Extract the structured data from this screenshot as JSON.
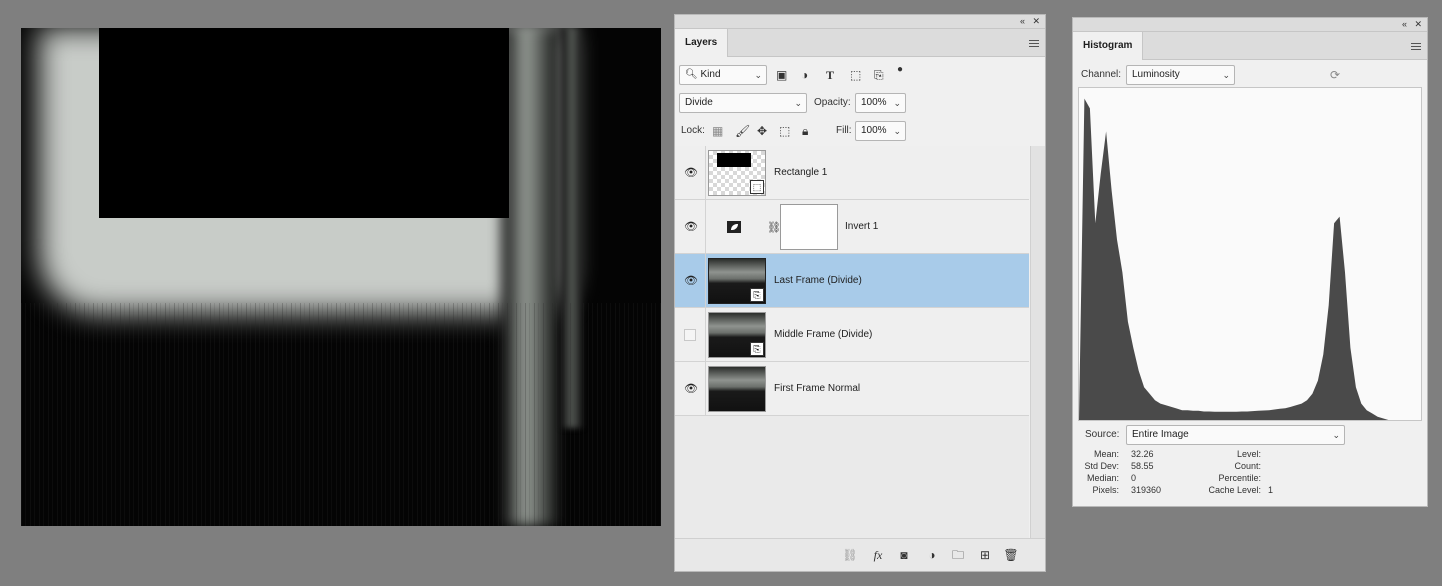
{
  "layers_panel": {
    "tab_label": "Layers",
    "filter": {
      "value": "Kind"
    },
    "blend_mode": "Divide",
    "opacity_label": "Opacity:",
    "opacity_value": "100%",
    "lock_label": "Lock:",
    "fill_label": "Fill:",
    "fill_value": "100%",
    "layers": [
      {
        "name": "Rectangle 1",
        "visible": true,
        "selected": false,
        "type": "shape"
      },
      {
        "name": "Invert 1",
        "visible": true,
        "selected": false,
        "type": "adjustment"
      },
      {
        "name": "Last Frame (Divide)",
        "visible": true,
        "selected": true,
        "type": "smart-object"
      },
      {
        "name": "Middle Frame (Divide)",
        "visible": false,
        "selected": false,
        "type": "smart-object"
      },
      {
        "name": "First Frame Normal",
        "visible": true,
        "selected": false,
        "type": "pixel"
      }
    ],
    "footer_icons": [
      "link-icon",
      "fx-icon",
      "mask-icon",
      "adjustment-icon",
      "folder-icon",
      "new-layer-icon",
      "trash-icon"
    ]
  },
  "histogram_panel": {
    "tab_label": "Histogram",
    "channel_label": "Channel:",
    "channel_value": "Luminosity",
    "source_label": "Source:",
    "source_value": "Entire Image",
    "stats_left": [
      {
        "label": "Mean:",
        "value": "32.26"
      },
      {
        "label": "Std Dev:",
        "value": "58.55"
      },
      {
        "label": "Median:",
        "value": "0"
      },
      {
        "label": "Pixels:",
        "value": "319360"
      }
    ],
    "stats_right": [
      {
        "label": "Level:",
        "value": ""
      },
      {
        "label": "Count:",
        "value": ""
      },
      {
        "label": "Percentile:",
        "value": ""
      },
      {
        "label": "Cache Level:",
        "value": "1"
      }
    ],
    "histogram_profile": [
      0,
      0.98,
      0.95,
      0.6,
      0.75,
      0.88,
      0.7,
      0.55,
      0.45,
      0.3,
      0.22,
      0.15,
      0.1,
      0.08,
      0.06,
      0.05,
      0.045,
      0.04,
      0.035,
      0.03,
      0.03,
      0.028,
      0.028,
      0.026,
      0.026,
      0.025,
      0.025,
      0.025,
      0.025,
      0.025,
      0.026,
      0.026,
      0.027,
      0.028,
      0.029,
      0.03,
      0.032,
      0.034,
      0.036,
      0.04,
      0.045,
      0.05,
      0.06,
      0.08,
      0.12,
      0.2,
      0.35,
      0.6,
      0.62,
      0.45,
      0.22,
      0.1,
      0.05,
      0.03,
      0.02,
      0.01,
      0.005,
      0,
      0,
      0,
      0,
      0,
      0,
      0
    ]
  },
  "colors": {
    "selected_row": "#a8cbe9",
    "panel_bg": "#f0f0f0",
    "workspace": "#7f7f7f",
    "histogram_fill": "#4a4a4a"
  }
}
